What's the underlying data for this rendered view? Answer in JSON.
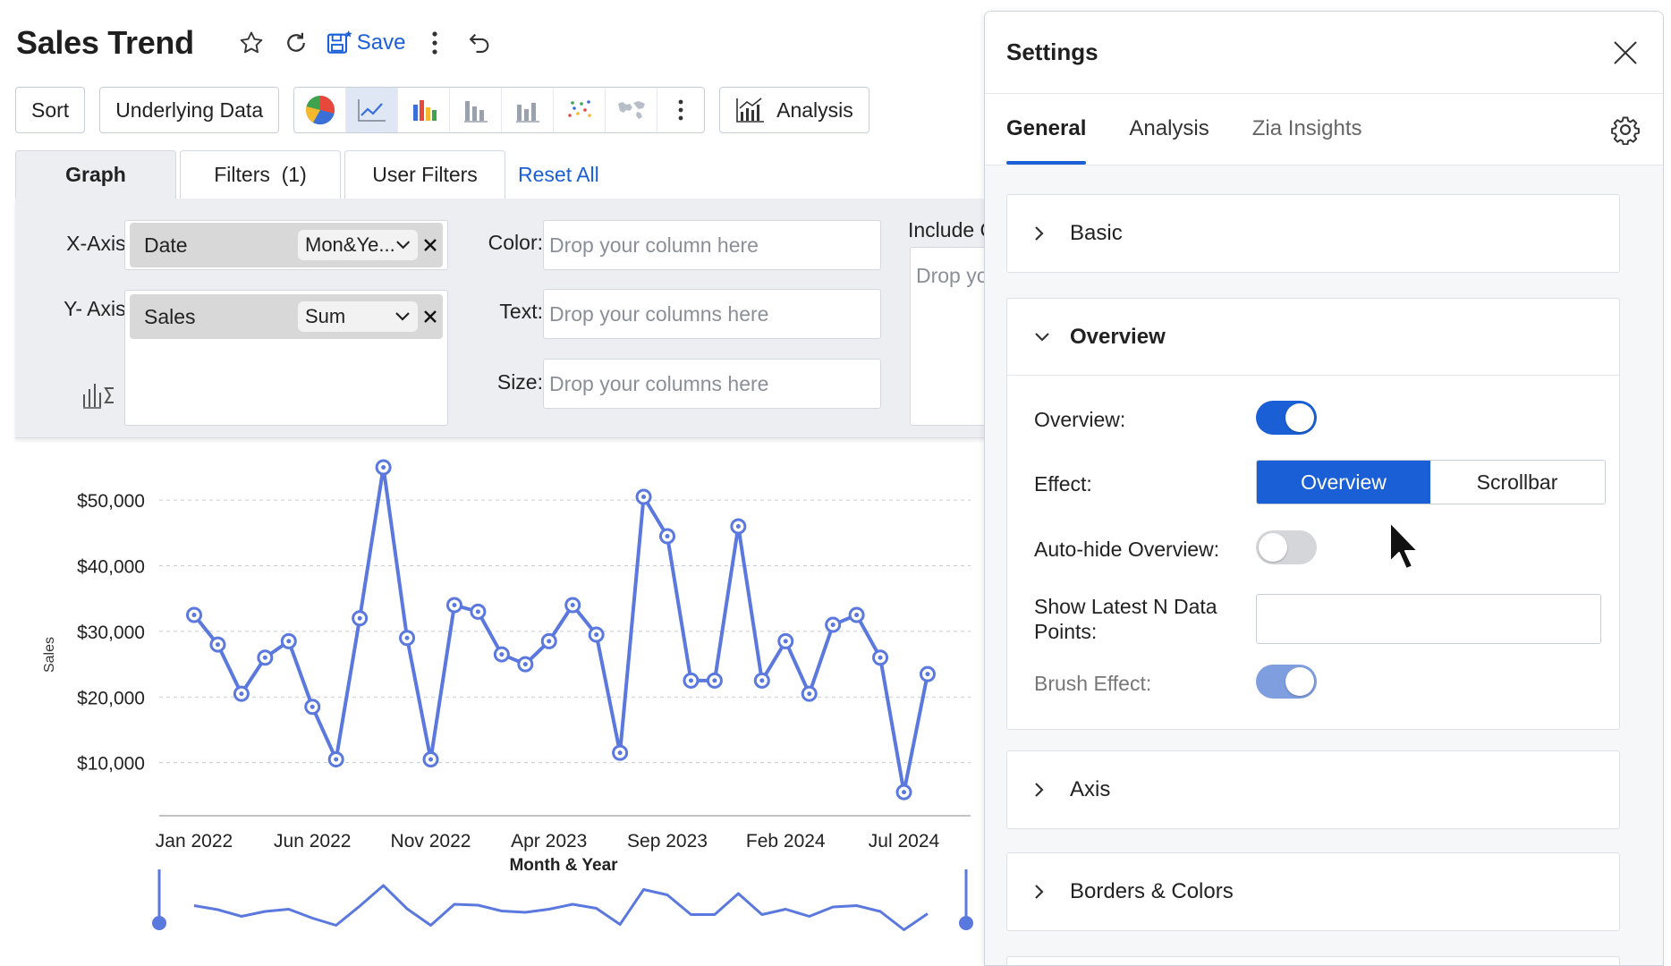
{
  "report": {
    "title": "Sales Trend",
    "save_label": "Save"
  },
  "toolbar": {
    "sort": "Sort",
    "underlying": "Underlying Data",
    "analysis": "Analysis"
  },
  "tabs": {
    "graph": "Graph",
    "filters": "Filters  (1)",
    "user_filters": "User Filters",
    "reset": "Reset All"
  },
  "shelf": {
    "x_label": "X-Axis:",
    "y_label": "Y- Axis:",
    "x_column": "Date",
    "x_agg": "Mon&Ye...",
    "y_column": "Sales",
    "y_agg": "Sum",
    "color_label": "Color:",
    "color_placeholder": "Drop your column here",
    "text_label": "Text:",
    "text_placeholder": "Drop your columns here",
    "size_label": "Size:",
    "size_placeholder": "Drop your columns here",
    "include_label": "Include C",
    "include_placeholder": "Drop you"
  },
  "chart_data": {
    "type": "line",
    "xlabel": "Month & Year",
    "ylabel": "Sales",
    "y_ticks": [
      "$10,000",
      "$20,000",
      "$30,000",
      "$40,000",
      "$50,000"
    ],
    "x_ticks": [
      "Jan 2022",
      "Jun 2022",
      "Nov 2022",
      "Apr 2023",
      "Sep 2023",
      "Feb 2024",
      "Jul 2024"
    ],
    "ylim": [
      0,
      55000
    ],
    "x": [
      "Jan 2022",
      "Feb 2022",
      "Mar 2022",
      "Apr 2022",
      "May 2022",
      "Jun 2022",
      "Jul 2022",
      "Aug 2022",
      "Sep 2022",
      "Oct 2022",
      "Nov 2022",
      "Dec 2022",
      "Jan 2023",
      "Feb 2023",
      "Mar 2023",
      "Apr 2023",
      "May 2023",
      "Jun 2023",
      "Jul 2023",
      "Aug 2023",
      "Sep 2023",
      "Oct 2023",
      "Nov 2023",
      "Dec 2023",
      "Jan 2024",
      "Feb 2024",
      "Mar 2024",
      "Apr 2024",
      "May 2024",
      "Jun 2024",
      "Jul 2024",
      "Aug 2024"
    ],
    "values": [
      32500,
      28000,
      20500,
      26000,
      28500,
      18500,
      10500,
      32000,
      55000,
      29000,
      10500,
      34000,
      33000,
      26500,
      25000,
      28500,
      34000,
      29500,
      11500,
      50500,
      44500,
      22500,
      22500,
      46000,
      22500,
      28500,
      20500,
      31000,
      32500,
      26000,
      5500,
      23500
    ],
    "color": "#5a78dd",
    "grid": true,
    "overview": true
  },
  "settings": {
    "title": "Settings",
    "tabs": [
      "General",
      "Analysis",
      "Zia Insights"
    ],
    "sections": {
      "basic": "Basic",
      "overview": "Overview",
      "axis": "Axis",
      "borders": "Borders & Colors"
    },
    "overview_label": "Overview:",
    "effect_label": "Effect:",
    "effect_options": [
      "Overview",
      "Scrollbar"
    ],
    "autohide_label": "Auto-hide Overview:",
    "latest_label_1": "Show Latest N Data",
    "latest_label_2": "Points:",
    "brush_label": "Brush Effect:",
    "overview_on": true,
    "autohide_on": false,
    "brush_on": true
  },
  "colors": {
    "accent": "#1a5fd6",
    "series": "#5a78dd"
  }
}
